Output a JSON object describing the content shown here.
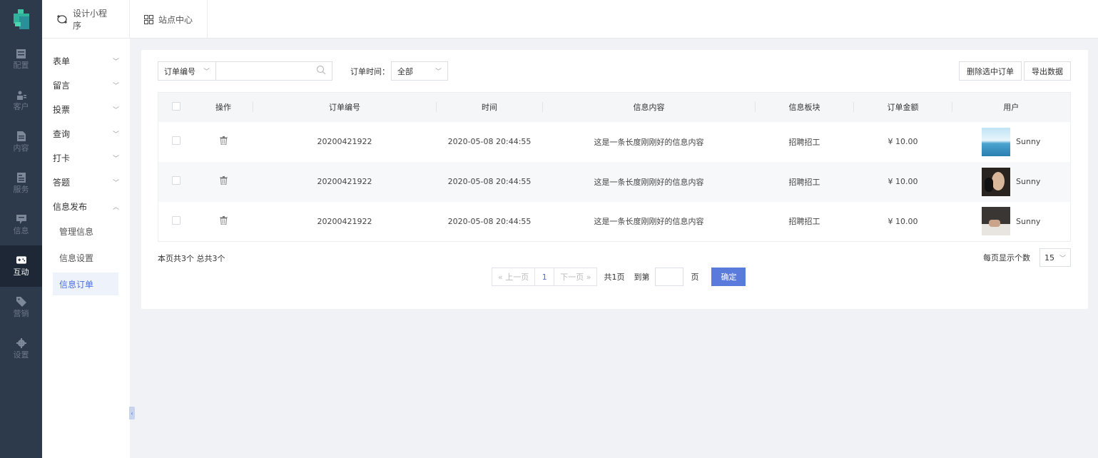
{
  "rail": {
    "items": [
      {
        "label": "配置",
        "icon": "config-icon"
      },
      {
        "label": "客户",
        "icon": "customer-icon"
      },
      {
        "label": "内容",
        "icon": "content-icon"
      },
      {
        "label": "服务",
        "icon": "service-icon"
      },
      {
        "label": "信息",
        "icon": "info-icon"
      },
      {
        "label": "互动",
        "icon": "gamepad-icon",
        "active": true
      },
      {
        "label": "营销",
        "icon": "tag-icon"
      },
      {
        "label": "设置",
        "icon": "gear-icon"
      }
    ]
  },
  "topbar": {
    "tabs": [
      {
        "label": "设计小程序",
        "icon": "mini-program-icon"
      },
      {
        "label": "站点中心",
        "icon": "grid-icon"
      }
    ]
  },
  "submenu": {
    "groups": [
      {
        "label": "表单",
        "expanded": false
      },
      {
        "label": "留言",
        "expanded": false
      },
      {
        "label": "投票",
        "expanded": false
      },
      {
        "label": "查询",
        "expanded": false
      },
      {
        "label": "打卡",
        "expanded": false
      },
      {
        "label": "答题",
        "expanded": false
      },
      {
        "label": "信息发布",
        "expanded": true
      }
    ],
    "children": [
      {
        "label": "管理信息"
      },
      {
        "label": "信息设置"
      },
      {
        "label": "信息订单",
        "active": true
      }
    ]
  },
  "filters": {
    "field_select": "订单编号",
    "search_value": "",
    "time_label": "订单时间：",
    "time_select": "全部"
  },
  "actions": {
    "delete_selected": "删除选中订单",
    "export": "导出数据"
  },
  "table": {
    "headers": [
      "操作",
      "订单编号",
      "时间",
      "信息内容",
      "信息板块",
      "订单金额",
      "用户"
    ],
    "rows": [
      {
        "order_no": "20200421922",
        "time": "2020-05-08 20:44:55",
        "content": "这是一条长度刚刚好的信息内容",
        "section": "招聘招工",
        "amount": "¥ 10.00",
        "user": "Sunny"
      },
      {
        "order_no": "20200421922",
        "time": "2020-05-08 20:44:55",
        "content": "这是一条长度刚刚好的信息内容",
        "section": "招聘招工",
        "amount": "¥ 10.00",
        "user": "Sunny"
      },
      {
        "order_no": "20200421922",
        "time": "2020-05-08 20:44:55",
        "content": "这是一条长度刚刚好的信息内容",
        "section": "招聘招工",
        "amount": "¥ 10.00",
        "user": "Sunny"
      }
    ]
  },
  "summary": "本页共3个 总共3个",
  "per_page": {
    "label": "每页显示个数",
    "value": "15"
  },
  "pager": {
    "prev": "« 上一页",
    "current": "1",
    "next": "下一页 »",
    "total_pages": "共1页",
    "goto_label": "到第",
    "page_unit": "页",
    "confirm": "确定"
  },
  "colors": {
    "accent": "#5a7bdc",
    "rail": "#2d3a4b"
  }
}
